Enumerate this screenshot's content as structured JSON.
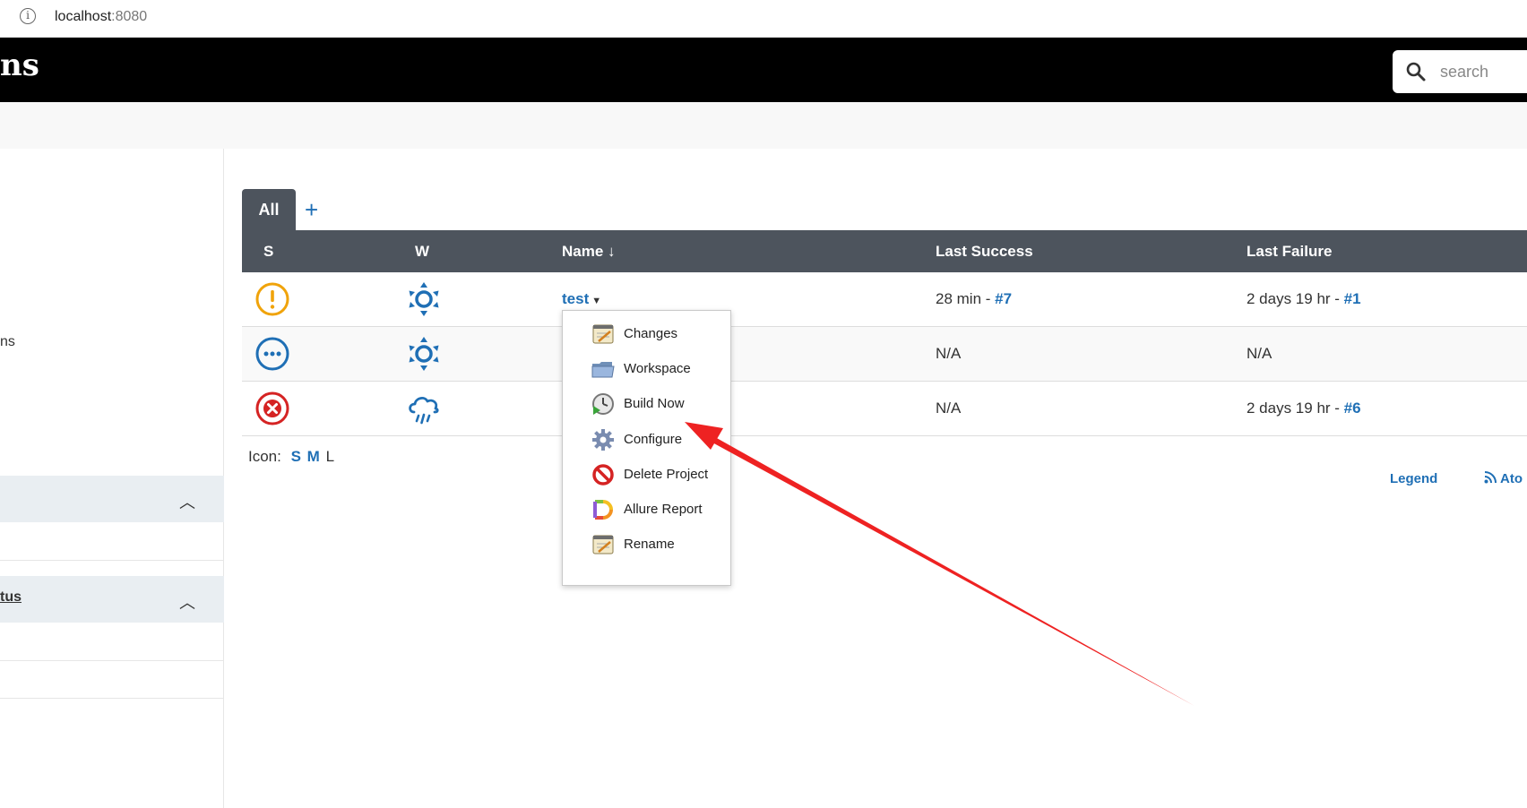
{
  "browser": {
    "url_host": "localhost",
    "url_port": ":8080"
  },
  "header": {
    "brand_fragment": "ns",
    "search_placeholder": "search"
  },
  "sidebar": {
    "partial_text": "ns",
    "pane2_title": "tus"
  },
  "tabs": {
    "active": "All",
    "add": "+"
  },
  "table": {
    "headers": {
      "s": "S",
      "w": "W",
      "name": "Name ↓",
      "last_success": "Last Success",
      "last_failure": "Last Failure"
    },
    "rows": [
      {
        "status_icon": "unstable-warning-icon",
        "weather_icon": "sunny-weather-icon",
        "name": "test",
        "last_success": "28 min",
        "last_success_sep": " - ",
        "last_success_build": "#7",
        "last_failure": "2 days 19 hr",
        "last_failure_sep": " - ",
        "last_failure_build": "#1"
      },
      {
        "status_icon": "not-built-icon",
        "weather_icon": "sunny-weather-icon",
        "name": "",
        "last_success": "N/A",
        "last_failure": "N/A"
      },
      {
        "status_icon": "failed-icon",
        "weather_icon": "rain-weather-icon",
        "name": "",
        "last_success": "N/A",
        "last_failure": "2 days 19 hr",
        "last_failure_sep": " - ",
        "last_failure_build": "#6"
      }
    ]
  },
  "icon_size": {
    "label": "Icon:",
    "s": "S",
    "m": "M",
    "l": "L"
  },
  "footer": {
    "legend": "Legend",
    "atom": "Ato"
  },
  "menu": {
    "items": [
      {
        "label": "Changes",
        "icon": "notepad-icon"
      },
      {
        "label": "Workspace",
        "icon": "folder-icon"
      },
      {
        "label": "Build Now",
        "icon": "build-clock-icon"
      },
      {
        "label": "Configure",
        "icon": "gear-icon"
      },
      {
        "label": "Delete Project",
        "icon": "no-entry-icon"
      },
      {
        "label": "Allure Report",
        "icon": "allure-logo-icon"
      },
      {
        "label": "Rename",
        "icon": "notepad-icon"
      }
    ]
  },
  "colors": {
    "accent": "#1f6fb5",
    "header_bg": "#000000",
    "table_head_bg": "#4d545d",
    "arrow": "#ee2222",
    "warning": "#f0a30a",
    "failed": "#d52323"
  }
}
